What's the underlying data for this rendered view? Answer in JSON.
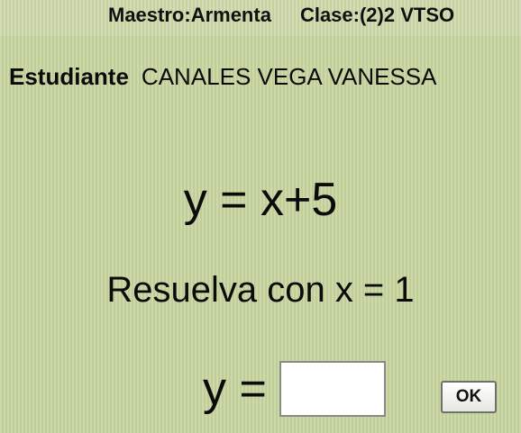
{
  "header": {
    "teacher_label": "Maestro:",
    "teacher_name": "Armenta",
    "class_label": "Clase:",
    "class_value": "(2)2 VTSO"
  },
  "student": {
    "label": "Estudiante",
    "name": "CANALES VEGA VANESSA"
  },
  "problem": {
    "equation": "y = x+5",
    "instruction": "Resuelva con x = 1"
  },
  "answer": {
    "label": "y =",
    "value": ""
  },
  "buttons": {
    "ok_label": "OK"
  }
}
